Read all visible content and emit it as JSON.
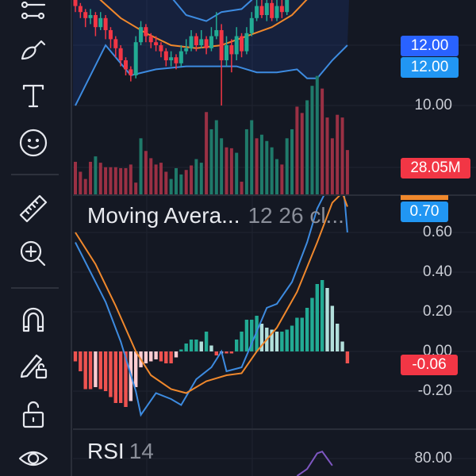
{
  "toolbar": {
    "tools": [
      {
        "name": "settings-lines-icon"
      },
      {
        "name": "brush-icon"
      },
      {
        "name": "text-icon"
      },
      {
        "name": "emoji-icon"
      },
      {
        "name": "ruler-icon"
      },
      {
        "name": "zoom-in-icon"
      },
      {
        "name": "magnet-icon"
      },
      {
        "name": "pencil-lock-icon"
      },
      {
        "name": "lock-icon"
      },
      {
        "name": "eye-icon"
      }
    ]
  },
  "price_axis": {
    "badge_price_1": "12.00",
    "badge_price_2": "12.00",
    "label_10": "10.00",
    "volume_badge": "28.05M"
  },
  "macd": {
    "legend_name": "Moving Avera...",
    "legend_params": "12 26 cl...",
    "badge_value": "0.70",
    "badge_hist": "-0.06",
    "ticks": [
      "0.60",
      "0.40",
      "0.20",
      "0.00",
      "-0.20"
    ]
  },
  "rsi": {
    "legend_name": "RSI",
    "legend_params": "14",
    "tick": "80.00"
  },
  "colors": {
    "background": "#141823",
    "up": "#22ab94",
    "down": "#f23645",
    "volume_up": "#1f7a6a",
    "volume_down": "#9a3044",
    "band": "#3d8be0",
    "basis": "#f0882c",
    "macd_line": "#3d8be0",
    "signal_line": "#f0882c",
    "hist_up_strong": "#22ab94",
    "hist_up_weak": "#b2dfdb",
    "hist_down_strong": "#ef5350",
    "hist_down_weak": "#ffcdd2",
    "rsi": "#7e57c2",
    "badge_dark_blue": "#2962ff",
    "badge_blue": "#2196f3",
    "badge_red": "#f23645"
  },
  "chart_data": {
    "type": "candlestick",
    "price_range": [
      10.0,
      13.5
    ],
    "candles": {
      "open": [
        13.5,
        13.3,
        13.1,
        12.9,
        13.0,
        12.6,
        12.9,
        12.5,
        12.2,
        11.9,
        11.5,
        11.2,
        11.0,
        12.1,
        12.6,
        12.3,
        12.1,
        12.0,
        11.8,
        11.5,
        11.6,
        11.4,
        11.8,
        11.9,
        12.3,
        12.0,
        12.2,
        11.9,
        12.3,
        12.5,
        11.5,
        12.0,
        11.7,
        12.3,
        11.8,
        12.4,
        12.9,
        13.3,
        13.0,
        13.4,
        12.9,
        13.3,
        13.1
      ],
      "high": [
        13.6,
        13.4,
        13.2,
        13.2,
        13.1,
        13.1,
        13.0,
        12.6,
        12.3,
        12.0,
        11.6,
        11.3,
        12.3,
        12.8,
        12.7,
        12.4,
        12.3,
        12.1,
        11.9,
        11.8,
        11.7,
        12.0,
        12.2,
        12.5,
        12.4,
        12.5,
        12.3,
        12.6,
        13.1,
        12.7,
        12.3,
        12.2,
        12.6,
        12.4,
        12.6,
        13.1,
        13.5,
        13.5,
        13.6,
        13.5,
        13.6,
        13.5,
        13.8
      ],
      "low": [
        13.1,
        12.9,
        12.6,
        12.7,
        12.3,
        12.5,
        12.2,
        11.9,
        11.6,
        11.3,
        11.0,
        10.8,
        10.9,
        12.0,
        12.1,
        11.9,
        11.8,
        11.6,
        11.3,
        11.3,
        11.2,
        11.3,
        11.7,
        11.8,
        11.8,
        11.9,
        11.7,
        11.8,
        12.2,
        10.0,
        11.3,
        11.1,
        11.5,
        11.6,
        11.7,
        12.3,
        12.8,
        12.9,
        12.8,
        12.8,
        12.8,
        12.9,
        13.0
      ],
      "close": [
        13.3,
        13.1,
        12.9,
        13.0,
        12.6,
        12.9,
        12.5,
        12.2,
        11.9,
        11.5,
        11.2,
        11.0,
        12.1,
        12.6,
        12.3,
        12.1,
        12.0,
        11.8,
        11.5,
        11.6,
        11.4,
        11.8,
        11.9,
        12.3,
        12.0,
        12.2,
        11.9,
        12.3,
        12.5,
        11.5,
        12.0,
        11.7,
        12.3,
        11.8,
        12.4,
        12.9,
        13.3,
        13.0,
        13.4,
        12.9,
        13.3,
        13.1,
        13.6
      ]
    },
    "bollinger": {
      "upper": [
        [
          17,
          14.0
        ],
        [
          19,
          13.6
        ],
        [
          22,
          13.0
        ],
        [
          26,
          12.8
        ],
        [
          29,
          13.1
        ],
        [
          33,
          13.2
        ],
        [
          35,
          13.5
        ],
        [
          37,
          14.2
        ]
      ],
      "basis": [
        [
          3,
          13.8
        ],
        [
          5,
          13.5
        ],
        [
          9,
          12.9
        ],
        [
          14,
          12.4
        ],
        [
          19,
          12.0
        ],
        [
          24,
          11.9
        ],
        [
          29,
          12.0
        ],
        [
          34,
          12.3
        ],
        [
          39,
          12.6
        ],
        [
          43,
          13.0
        ],
        [
          47,
          13.7
        ]
      ],
      "lower": [
        [
          0,
          10.0
        ],
        [
          6,
          12.0
        ],
        [
          8,
          11.6
        ],
        [
          11,
          11.0
        ],
        [
          16,
          11.2
        ],
        [
          22,
          11.3
        ],
        [
          28,
          11.3
        ],
        [
          32,
          11.3
        ],
        [
          36,
          11.1
        ],
        [
          40,
          11.1
        ],
        [
          44,
          11.2
        ],
        [
          46,
          10.9
        ],
        [
          48,
          10.9
        ],
        [
          51,
          11.5
        ],
        [
          54,
          12.0
        ]
      ]
    },
    "volume_millions": [
      36,
      25,
      17,
      36,
      42,
      35,
      30,
      30,
      30,
      29,
      29,
      33,
      13,
      62,
      48,
      40,
      33,
      35,
      25,
      17,
      29,
      22,
      27,
      32,
      39,
      35,
      91,
      72,
      82,
      62,
      52,
      51,
      46,
      14,
      72,
      82,
      62,
      66,
      59,
      52,
      39,
      33,
      62,
      72,
      97,
      90,
      104,
      120,
      131,
      117,
      85,
      62,
      88,
      85,
      49
    ],
    "volume_direction": "ddddudddddddduddddduuudduuduuudduduuduuuuduudduuudddddd",
    "macd_histogram": [
      -0.05,
      -0.1,
      -0.19,
      -0.19,
      -0.18,
      -0.19,
      -0.2,
      -0.23,
      -0.26,
      -0.26,
      -0.28,
      -0.25,
      -0.18,
      -0.08,
      -0.06,
      -0.05,
      -0.04,
      -0.05,
      -0.06,
      -0.06,
      -0.03,
      0.01,
      0.04,
      0.06,
      0.06,
      0.05,
      0.1,
      0.03,
      -0.02,
      -0.01,
      -0.01,
      -0.01,
      0.06,
      0.1,
      0.16,
      0.16,
      0.18,
      0.14,
      0.12,
      0.11,
      0.1,
      0.1,
      0.11,
      0.13,
      0.17,
      0.17,
      0.22,
      0.27,
      0.34,
      0.36,
      0.32,
      0.23,
      0.14,
      0.05,
      -0.06
    ],
    "macd_line": [
      [
        0,
        0.55
      ],
      [
        3,
        0.4
      ],
      [
        6,
        0.25
      ],
      [
        9,
        0.05
      ],
      [
        12,
        -0.2
      ],
      [
        13,
        -0.32
      ],
      [
        16,
        -0.21
      ],
      [
        19,
        -0.24
      ],
      [
        21,
        -0.27
      ],
      [
        24,
        -0.14
      ],
      [
        27,
        -0.08
      ],
      [
        29,
        0.0
      ],
      [
        30,
        -0.1
      ],
      [
        33,
        -0.08
      ],
      [
        35,
        0.04
      ],
      [
        38,
        0.22
      ],
      [
        40,
        0.24
      ],
      [
        43,
        0.35
      ],
      [
        46,
        0.55
      ],
      [
        48,
        0.72
      ],
      [
        50,
        0.82
      ],
      [
        53,
        0.9
      ],
      [
        54,
        0.6
      ]
    ],
    "signal_line": [
      [
        0,
        0.6
      ],
      [
        4,
        0.44
      ],
      [
        8,
        0.23
      ],
      [
        12,
        0.0
      ],
      [
        15,
        -0.12
      ],
      [
        19,
        -0.19
      ],
      [
        22,
        -0.21
      ],
      [
        26,
        -0.15
      ],
      [
        30,
        -0.12
      ],
      [
        33,
        -0.11
      ],
      [
        36,
        0.0
      ],
      [
        40,
        0.12
      ],
      [
        44,
        0.3
      ],
      [
        48,
        0.55
      ],
      [
        51,
        0.75
      ],
      [
        53,
        0.8
      ],
      [
        54,
        0.73
      ]
    ],
    "macd_range": [
      -0.4,
      0.8
    ],
    "rsi_line": [
      [
        44,
        70
      ],
      [
        46,
        74
      ],
      [
        48,
        83
      ],
      [
        49,
        84
      ],
      [
        50,
        80
      ],
      [
        51,
        76
      ]
    ],
    "rsi_range": [
      70,
      85
    ]
  }
}
